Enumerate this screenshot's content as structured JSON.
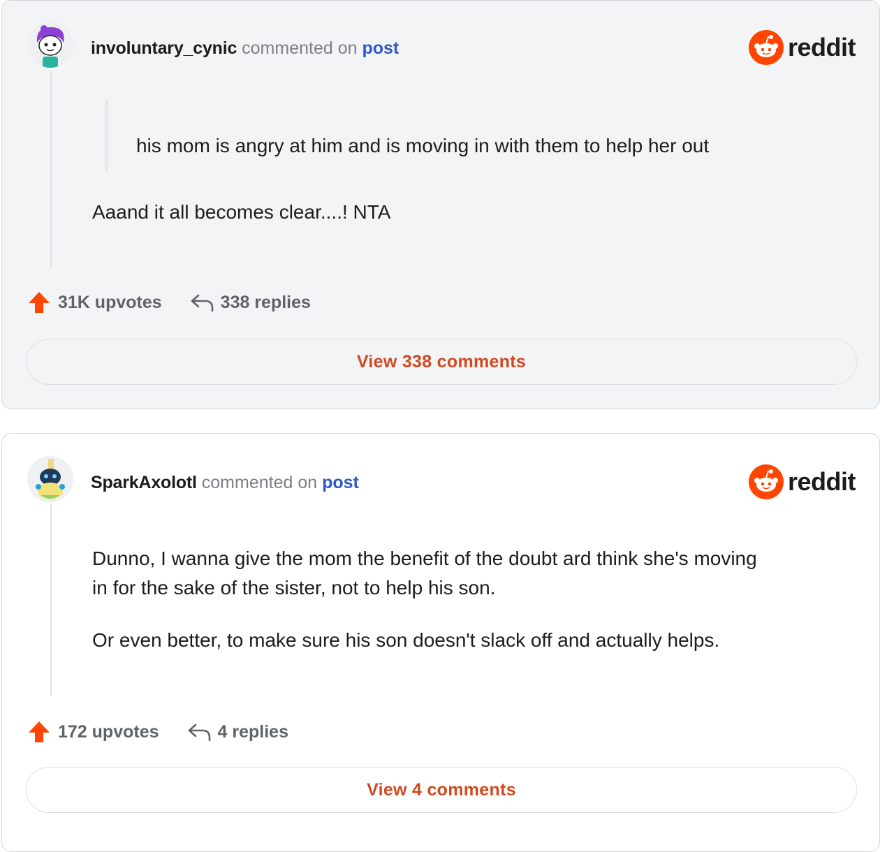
{
  "brand": {
    "name": "reddit",
    "accent": "#ff4500",
    "link_color": "#2f58c8",
    "button_text_color": "#cf4a21"
  },
  "cards": [
    {
      "username": "involuntary_cynic",
      "commented_on": "commented on",
      "post_link": "post",
      "quote": "his mom is angry at him and is moving in with them to help her out",
      "paragraphs": [
        "Aaand it all becomes clear....! NTA"
      ],
      "upvotes": "31K upvotes",
      "replies": "338 replies",
      "view_button": "View 338 comments",
      "avatar_icon": "purple-hair-avatar-icon"
    },
    {
      "username": "SparkAxolotl",
      "commented_on": "commented on",
      "post_link": "post",
      "paragraphs": [
        "Dunno, I wanna give the mom the benefit of the doubt ard think she's moving",
        "in for the sake of the sister, not to help his son.",
        "Or even better, to make sure his son doesn't slack off and actually helps."
      ],
      "upvotes": "172 upvotes",
      "replies": "4 replies",
      "view_button": "View 4 comments",
      "avatar_icon": "robot-axolotl-avatar-icon"
    }
  ],
  "icons": {
    "upvote": "upvote-arrow-icon",
    "reply": "reply-arrow-icon",
    "logo": "reddit-snoo-icon"
  }
}
